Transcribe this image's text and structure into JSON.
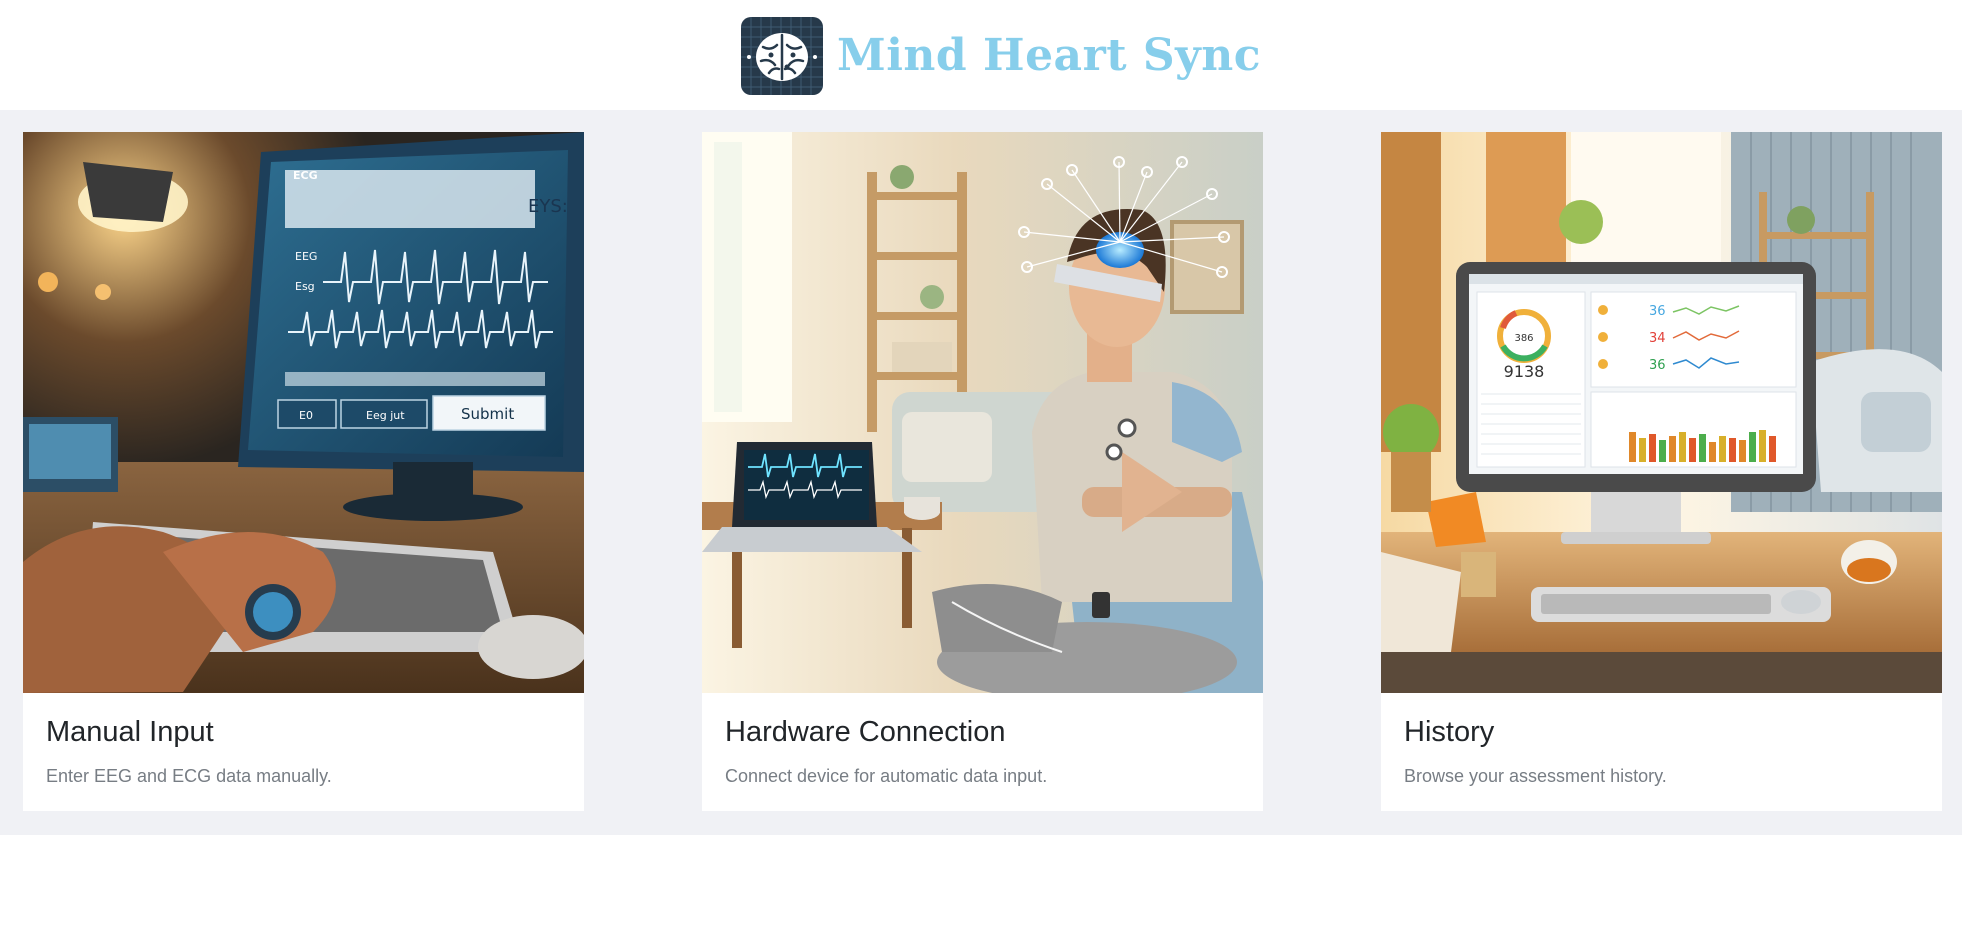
{
  "header": {
    "title": "Mind Heart Sync",
    "logo_icon": "brain-circuit-icon"
  },
  "cards": [
    {
      "title": "Manual Input",
      "description": "Enter EEG and ECG data manually.",
      "image": {
        "screen_title": "ECG",
        "row1": "EEG",
        "row2": "Esg",
        "button_1": "E0",
        "button_2": "Eeg jut",
        "submit": "Submit",
        "screen_badge": "EYS:"
      }
    },
    {
      "title": "Hardware Connection",
      "description": "Connect device for automatic data input."
    },
    {
      "title": "History",
      "description": "Browse your assessment history.",
      "image": {
        "gauge_value": "386",
        "score": "9138",
        "metric_1": "36",
        "metric_2": "34",
        "metric_3": "36"
      }
    }
  ],
  "colors": {
    "brand": "#87ceeb",
    "band": "#f0f1f5",
    "card_title": "#212529",
    "card_desc": "#777d84"
  }
}
